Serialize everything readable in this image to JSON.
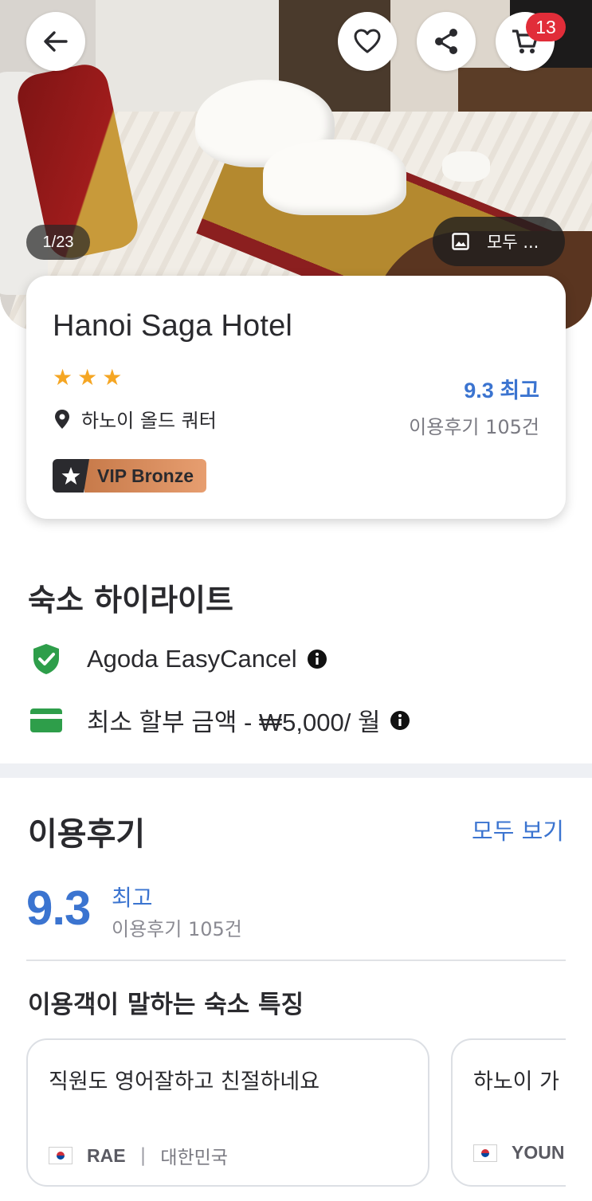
{
  "header": {
    "photo_counter": "1/23",
    "gallery_label": "모두 ...",
    "cart_count": "13",
    "icons": [
      "back-arrow-icon",
      "heart-icon",
      "share-icon",
      "cart-icon",
      "image-icon"
    ]
  },
  "hotel": {
    "name": "Hanoi Saga Hotel",
    "star_rating": 3,
    "location": "하노이 올드 쿼터",
    "score": "9.3 최고",
    "review_count": "이용후기 105건",
    "vip_label": "VIP Bronze"
  },
  "highlights": {
    "title": "숙소 하이라이트",
    "items": [
      {
        "icon": "shield-check-icon",
        "label": "Agoda EasyCancel"
      },
      {
        "icon": "credit-card-icon",
        "label": "최소 할부 금액 - ₩5,000/ 월"
      }
    ]
  },
  "reviews": {
    "title": "이용후기",
    "see_all": "모두 보기",
    "score": "9.3",
    "score_word": "최고",
    "count": "이용후기 105건",
    "features_title": "이용객이 말하는 숙소 특징",
    "cards": [
      {
        "text": "직원도 영어잘하고 친절하네요",
        "name": "RAE",
        "separator": "|",
        "country": "대한민국"
      },
      {
        "text": "하노이 가",
        "name": "YOUN",
        "separator": "",
        "country": ""
      }
    ]
  },
  "colors": {
    "accent_blue": "#3b74d0",
    "star": "#f5a623",
    "badge_red": "#e12d39",
    "shield_green": "#2e9e4a",
    "vip_bronze": "#e79e70"
  }
}
